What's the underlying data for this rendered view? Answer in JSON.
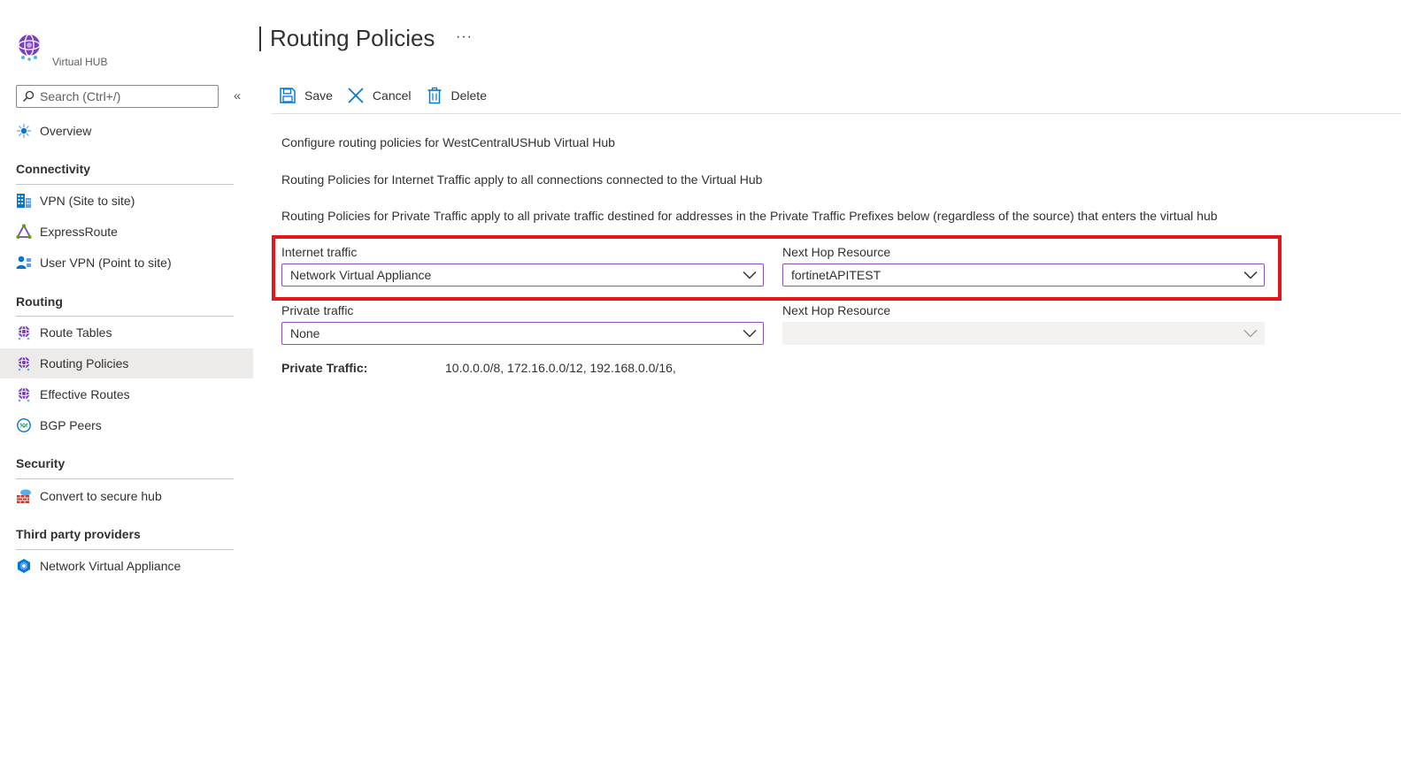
{
  "sidebar": {
    "hub_label": "Virtual HUB",
    "search_placeholder": "Search (Ctrl+/)",
    "collapse_glyph": "«",
    "overview": {
      "label": "Overview",
      "icon": "overview-icon"
    },
    "sections": [
      {
        "title": "Connectivity",
        "items": [
          {
            "label": "VPN (Site to site)",
            "icon": "vpn-icon"
          },
          {
            "label": "ExpressRoute",
            "icon": "expressroute-icon"
          },
          {
            "label": "User VPN (Point to site)",
            "icon": "user-vpn-icon"
          }
        ]
      },
      {
        "title": "Routing",
        "items": [
          {
            "label": "Route Tables",
            "icon": "route-tables-icon"
          },
          {
            "label": "Routing Policies",
            "icon": "routing-policies-icon",
            "active": true
          },
          {
            "label": "Effective Routes",
            "icon": "effective-routes-icon"
          },
          {
            "label": "BGP Peers",
            "icon": "bgp-peers-icon"
          }
        ]
      },
      {
        "title": "Security",
        "items": [
          {
            "label": "Convert to secure hub",
            "icon": "firewall-icon"
          }
        ]
      },
      {
        "title": "Third party providers",
        "items": [
          {
            "label": "Network Virtual Appliance",
            "icon": "nva-icon"
          }
        ]
      }
    ]
  },
  "header": {
    "title": "Routing Policies",
    "more_glyph": "···"
  },
  "toolbar": {
    "save_label": "Save",
    "cancel_label": "Cancel",
    "delete_label": "Delete"
  },
  "content": {
    "desc_1": "Configure routing policies for WestCentralUSHub Virtual Hub",
    "desc_2": "Routing Policies for Internet Traffic apply to all connections connected to the Virtual Hub",
    "desc_3": "Routing Policies for Private Traffic apply to all private traffic destined for addresses in the Private Traffic Prefixes below (regardless of the source) that enters the virtual hub",
    "internet_traffic": {
      "label": "Internet traffic",
      "value": "Network Virtual Appliance"
    },
    "internet_next_hop": {
      "label": "Next Hop Resource",
      "value": "fortinetAPITEST"
    },
    "private_traffic": {
      "label": "Private traffic",
      "value": "None"
    },
    "private_next_hop": {
      "label": "Next Hop Resource",
      "value": ""
    },
    "private_prefixes_label": "Private Traffic:",
    "private_prefixes_value": "10.0.0.0/8, 172.16.0.0/12, 192.168.0.0/16,"
  },
  "colors": {
    "accent_purple": "#8f4fb3",
    "highlight_red": "#e3161b",
    "azure_blue": "#0078d4"
  }
}
